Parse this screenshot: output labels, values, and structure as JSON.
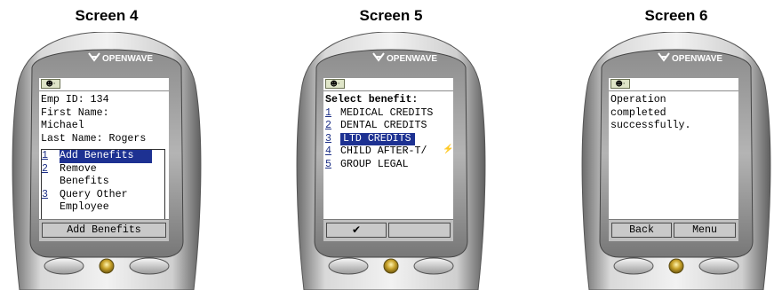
{
  "screens": [
    {
      "caption": "Screen 4",
      "brand": "OPENWAVE",
      "status_icon": "☻·",
      "lines": [
        "Emp ID: 134",
        "First Name:",
        "Michael",
        "Last Name: Rogers"
      ],
      "menu": [
        {
          "num": "1",
          "text": "Add Benefits",
          "selected": true
        },
        {
          "num": "2",
          "text": "Remove",
          "selected": false
        },
        {
          "num": "",
          "text": "Benefits",
          "selected": false
        },
        {
          "num": "3",
          "text": "Query Other",
          "selected": false
        },
        {
          "num": "",
          "text": "Employee",
          "selected": false
        }
      ],
      "softkey": "Add Benefits"
    },
    {
      "caption": "Screen 5",
      "brand": "OPENWAVE",
      "status_icon": "☻·",
      "title": "Select benefit:",
      "menu": [
        {
          "num": "1",
          "text": "MEDICAL CREDITS",
          "selected": false
        },
        {
          "num": "2",
          "text": "DENTAL CREDITS",
          "selected": false
        },
        {
          "num": "3",
          "text": "LTD CREDITS",
          "selected": true
        },
        {
          "num": "4",
          "text": "CHILD AFTER-T/",
          "selected": false
        },
        {
          "num": "5",
          "text": "GROUP LEGAL",
          "selected": false
        }
      ],
      "softkey_icon": "check-icon"
    },
    {
      "caption": "Screen 6",
      "brand": "OPENWAVE",
      "status_icon": "☻·",
      "lines": [
        "Operation",
        "completed",
        "successfully."
      ],
      "softkey_left": "Back",
      "softkey_right": "Menu"
    }
  ]
}
